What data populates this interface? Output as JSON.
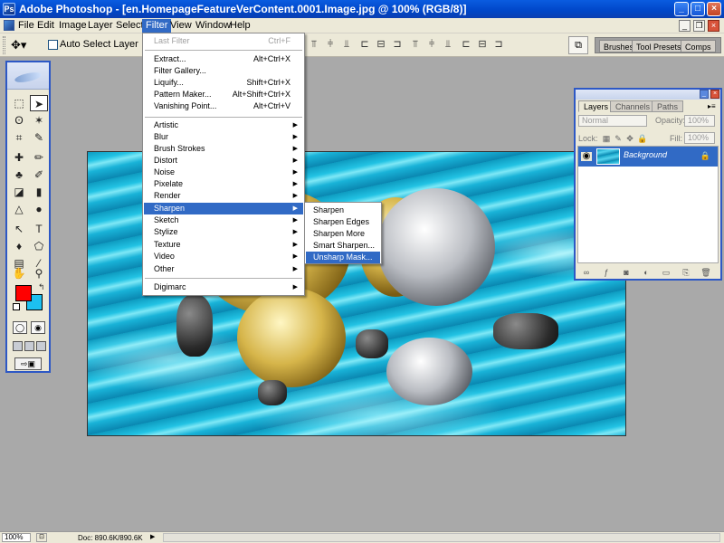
{
  "window": {
    "title": "Adobe Photoshop - [en.HomepageFeatureVerContent.0001.Image.jpg @ 100% (RGB/8)]",
    "app_icon": "Ps",
    "controls": {
      "minimize": "_",
      "maximize": "□",
      "close": "×"
    }
  },
  "menubar": {
    "items": [
      "File",
      "Edit",
      "Image",
      "Layer",
      "Select",
      "Filter",
      "View",
      "Window",
      "Help"
    ],
    "active": "Filter"
  },
  "options_bar": {
    "tool_preset_icon": "move-tool-icon",
    "auto_select_label": "Auto Select Layer",
    "auto_select_checked": false,
    "palette_well_tabs": [
      "Brushes",
      "Tool Presets",
      "Comps"
    ]
  },
  "filter_menu": {
    "last_filter": {
      "label": "Last Filter",
      "shortcut": "Ctrl+F"
    },
    "group1": [
      {
        "label": "Extract...",
        "shortcut": "Alt+Ctrl+X"
      },
      {
        "label": "Filter Gallery...",
        "shortcut": ""
      },
      {
        "label": "Liquify...",
        "shortcut": "Shift+Ctrl+X"
      },
      {
        "label": "Pattern Maker...",
        "shortcut": "Alt+Shift+Ctrl+X"
      },
      {
        "label": "Vanishing Point...",
        "shortcut": "Alt+Ctrl+V"
      }
    ],
    "group2": [
      "Artistic",
      "Blur",
      "Brush Strokes",
      "Distort",
      "Noise",
      "Pixelate",
      "Render",
      "Sharpen",
      "Sketch",
      "Stylize",
      "Texture",
      "Video",
      "Other"
    ],
    "highlighted": "Sharpen",
    "group3": [
      "Digimarc"
    ]
  },
  "sharpen_submenu": {
    "items": [
      "Sharpen",
      "Sharpen Edges",
      "Sharpen More",
      "Smart Sharpen...",
      "Unsharp Mask..."
    ],
    "highlighted": "Unsharp Mask..."
  },
  "layers_palette": {
    "tabs": [
      "Layers",
      "Channels",
      "Paths"
    ],
    "active_tab": "Layers",
    "blend_mode": "Normal",
    "opacity_label": "Opacity:",
    "opacity_value": "100%",
    "lock_label": "Lock:",
    "fill_label": "Fill:",
    "fill_value": "100%",
    "layers": [
      {
        "name": "Background",
        "visible": true,
        "locked": true
      }
    ]
  },
  "statusbar": {
    "zoom": "100%",
    "doc_size": "Doc: 890.6K/890.6K"
  },
  "colors": {
    "foreground": "#ff0000",
    "background": "#1cc0f0",
    "highlight": "#316ac5"
  }
}
